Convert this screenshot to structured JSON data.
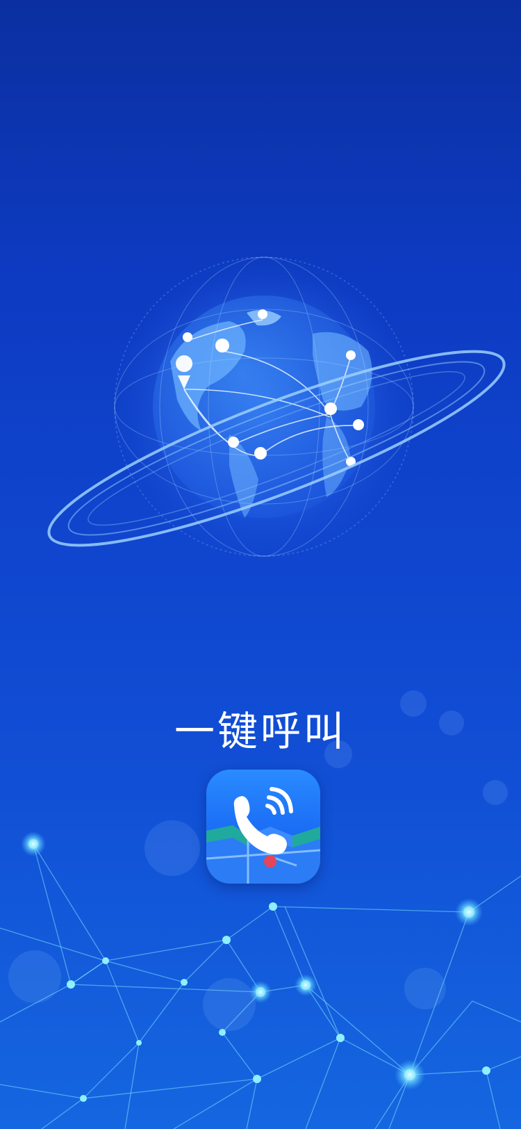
{
  "splash": {
    "title": "一键呼叫",
    "icons": {
      "globe": "globe-network-icon",
      "app": "phone-call-map-icon",
      "network": "network-mesh-icon"
    },
    "colors": {
      "top": "#0b2fa0",
      "middle": "#1046cf",
      "bottom": "#1566e0",
      "title": "#ffffff"
    }
  }
}
